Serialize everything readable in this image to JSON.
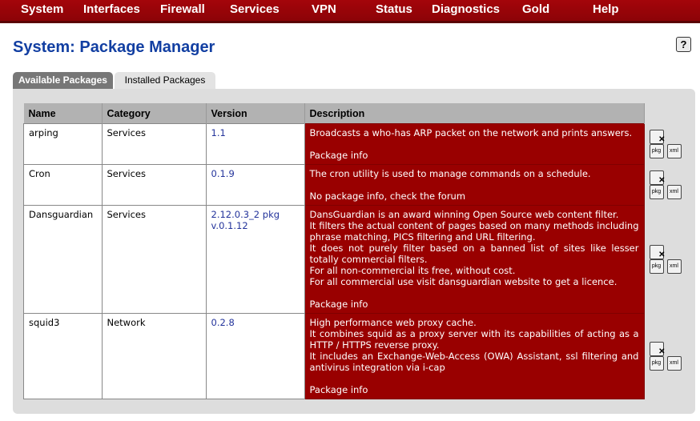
{
  "nav": {
    "items": [
      {
        "label": "System"
      },
      {
        "label": "Interfaces"
      },
      {
        "label": "Firewall"
      },
      {
        "label": "Services"
      },
      {
        "label": "VPN"
      },
      {
        "label": "Status"
      },
      {
        "label": "Diagnostics"
      },
      {
        "label": "Gold"
      },
      {
        "label": "Help"
      }
    ]
  },
  "page": {
    "title": "System: Package Manager",
    "help_label": "?"
  },
  "tabs": [
    {
      "label": "Available Packages",
      "active": true
    },
    {
      "label": "Installed Packages",
      "active": false
    }
  ],
  "table": {
    "headers": [
      "Name",
      "Category",
      "Version",
      "Description"
    ],
    "rows": [
      {
        "name": "arping",
        "category": "Services",
        "version": [
          "1.1"
        ],
        "description": [
          "Broadcasts a who-has ARP packet on the network and prints answers."
        ],
        "info": "Package info"
      },
      {
        "name": "Cron",
        "category": "Services",
        "version": [
          "0.1.9"
        ],
        "description": [
          "The cron utility is used to manage commands on a schedule."
        ],
        "info": "No package info, check the forum"
      },
      {
        "name": "Dansguardian",
        "category": "Services",
        "version": [
          "2.12.0.3_2 pkg",
          "v.0.1.12"
        ],
        "description": [
          "DansGuardian is an award winning Open Source web content filter.",
          "It filters the actual content of pages based on many methods including phrase matching, PICS filtering and URL filtering.",
          "It does not purely filter based on a banned list of sites like lesser totally commercial filters.",
          "For all non-commercial its free, without cost.",
          "For all commercial use visit dansguardian website to get a licence."
        ],
        "info": "Package info"
      },
      {
        "name": "squid3",
        "category": "Network",
        "version": [
          "0.2.8"
        ],
        "description": [
          "High performance web proxy cache.",
          "It combines squid as a proxy server with its capabilities of acting as a HTTP / HTTPS reverse proxy.",
          "It includes an Exchange-Web-Access (OWA) Assistant, ssl filtering and antivirus integration via i-cap"
        ],
        "info": "Package info"
      }
    ]
  },
  "actions": {
    "pkg_label": "pkg",
    "xml_label": "xml"
  },
  "colors": {
    "nav_bg": "#a4050a",
    "title": "#123fa2",
    "desc_bg": "#990000"
  }
}
